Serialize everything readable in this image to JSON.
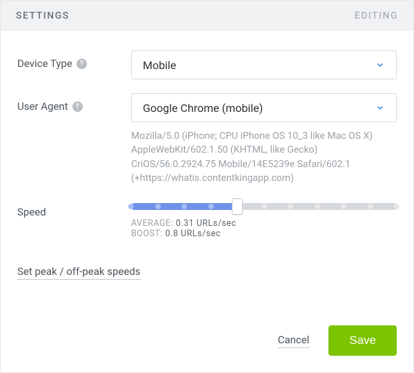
{
  "header": {
    "title": "SETTINGS",
    "mode": "EDITING"
  },
  "fields": {
    "device_type": {
      "label": "Device Type",
      "value": "Mobile"
    },
    "user_agent": {
      "label": "User Agent",
      "value": "Google Chrome (mobile)",
      "raw": "Mozilla/5.0 (iPhone; CPU iPhone OS 10_3 like Mac OS X) AppleWebKit/602.1.50 (KHTML, like Gecko) CriOS/56.0.2924.75 Mobile/14E5239e Safari/602.1 (+https://whatis.contentkingapp.com)"
    },
    "speed": {
      "label": "Speed",
      "slider": {
        "steps": 11,
        "position_index": 4
      },
      "avg_label": "AVERAGE:",
      "avg_value": "0.31 URLs/sec",
      "boost_label": "BOOST:",
      "boost_value": "0.8 URLs/sec"
    }
  },
  "links": {
    "peak": "Set peak / off-peak speeds"
  },
  "actions": {
    "cancel": "Cancel",
    "save": "Save"
  }
}
